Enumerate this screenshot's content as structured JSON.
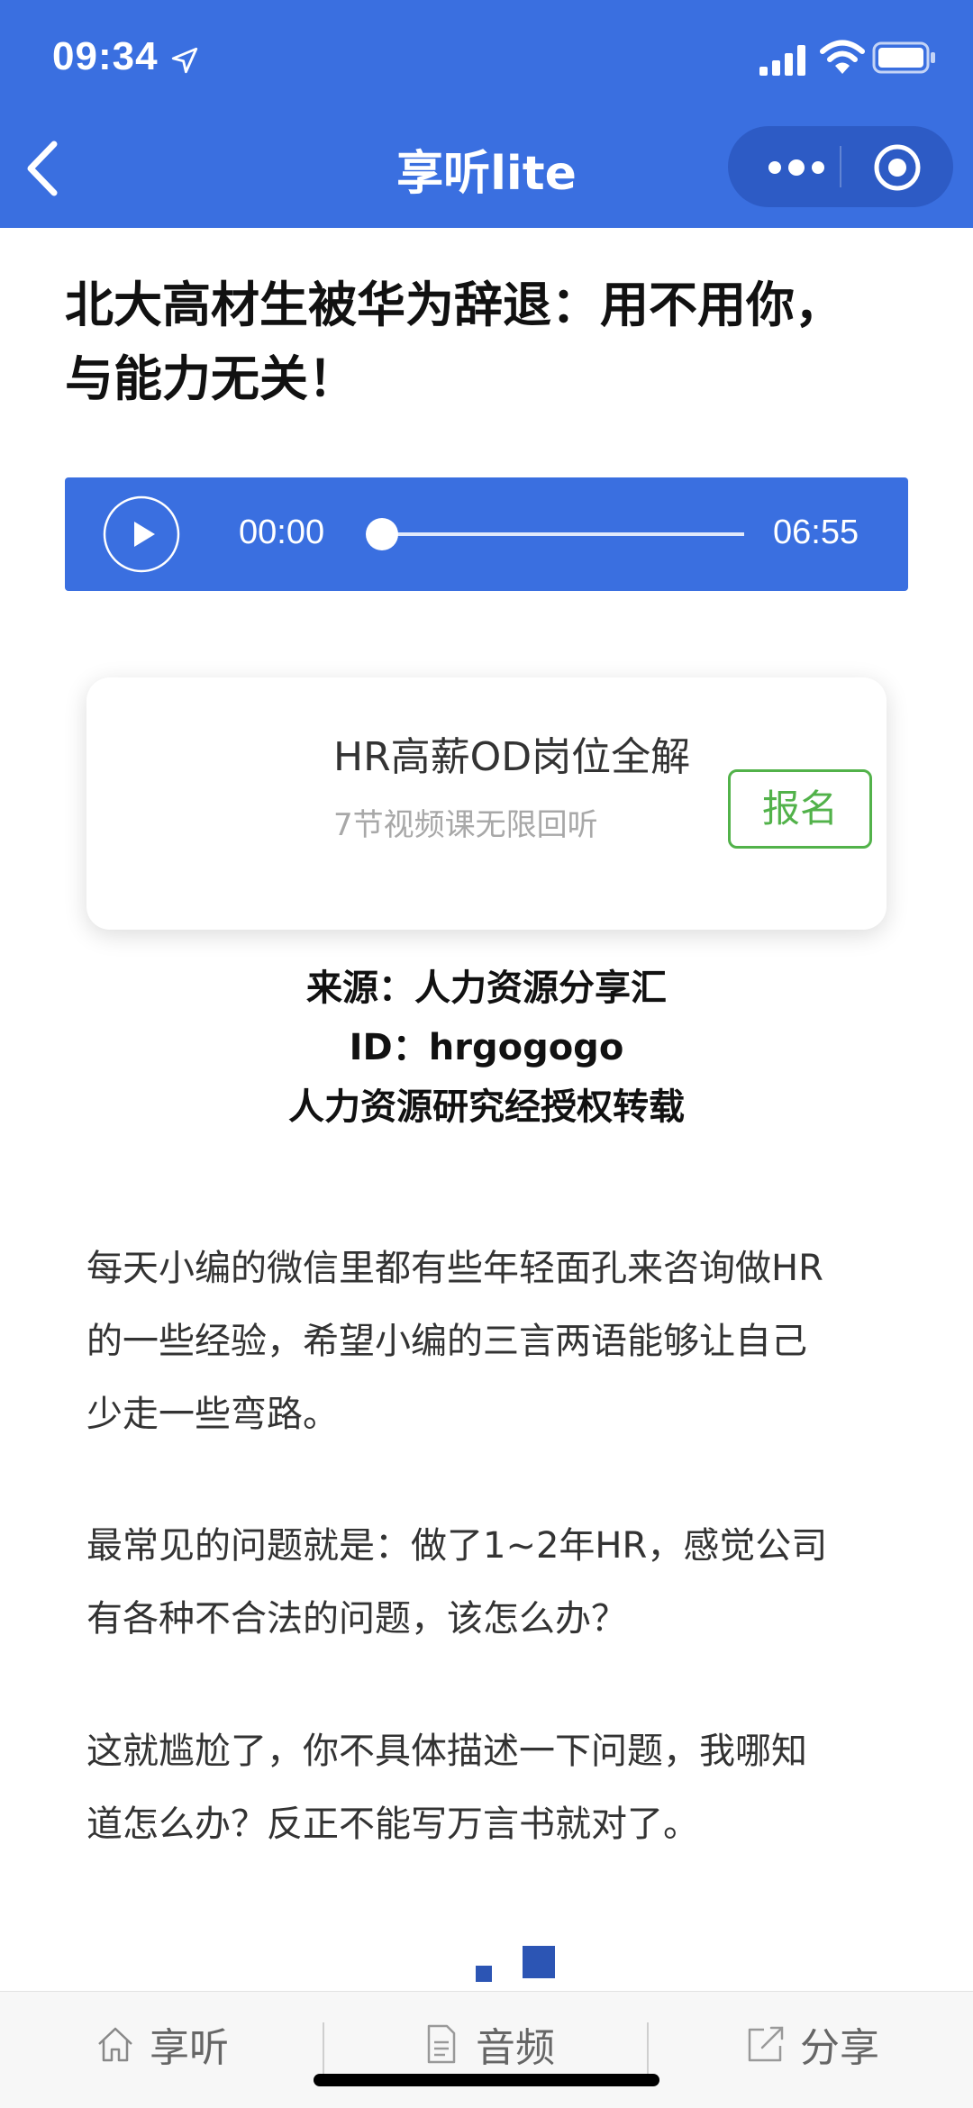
{
  "status_bar": {
    "time": "09:34",
    "icons": [
      "location-arrow-icon",
      "cellular-signal-icon",
      "wifi-icon",
      "battery-icon"
    ]
  },
  "nav": {
    "title": "享听lite",
    "back_icon": "chevron-left-icon",
    "more_icon": "more-dots-icon",
    "close_icon": "target-close-icon"
  },
  "article": {
    "title_line1": "北大高材生被华为辞退：用不用你，",
    "title_line2": "与能力无关！"
  },
  "player": {
    "current_time": "00:00",
    "total_time": "06:55",
    "progress": 0,
    "play_icon": "play-icon"
  },
  "ad": {
    "title": "HR高薪OD岗位全解",
    "subtitle": "7节视频课无限回听",
    "button_label": "报名"
  },
  "source": {
    "line1": "来源：人力资源分享汇",
    "line2": "ID：hrgogogo",
    "line3": "人力资源研究经授权转载"
  },
  "paragraphs": [
    {
      "line1": "每天小编的微信里都有些年轻面孔来咨询做HR",
      "line2": "的一些经验，希望小编的三言两语能够让自己",
      "line3": "少走一些弯路。"
    },
    {
      "line1": "最常见的问题就是：做了1~2年HR，感觉公司",
      "line2": "有各种不合法的问题，该怎么办？"
    },
    {
      "line1": "这就尴尬了，你不具体描述一下问题，我哪知",
      "line2": "道怎么办？反正不能写万言书就对了。"
    }
  ],
  "tabbar": {
    "tabs": [
      {
        "label": "享听",
        "icon": "home-icon"
      },
      {
        "label": "音频",
        "icon": "document-icon"
      },
      {
        "label": "分享",
        "icon": "share-icon"
      }
    ]
  },
  "colors": {
    "brand_blue": "#3a6fe0",
    "signup_green": "#52b24a"
  }
}
